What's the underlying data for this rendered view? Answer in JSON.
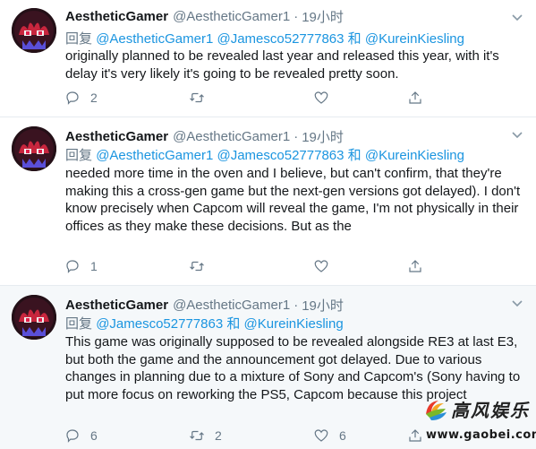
{
  "colors": {
    "accent": "#1b95e0",
    "muted": "#657786",
    "text": "#14171a",
    "divider": "#e6ecf0",
    "highlight_bg": "#f5f8fa"
  },
  "tweets": [
    {
      "display_name": "AestheticGamer",
      "handle": "@AestheticGamer1",
      "dot": "·",
      "time": "19小时",
      "reply_prefix": "回复",
      "mention_1": "@AestheticGamer1",
      "mention_2": "@Jamesco52777863",
      "and_word": "和",
      "mention_3": "@KureinKiesling",
      "text": "originally planned to be revealed last year and released this year, with it's delay it's very likely it's going to be revealed pretty soon.",
      "replies": "2",
      "retweets": "",
      "likes": ""
    },
    {
      "display_name": "AestheticGamer",
      "handle": "@AestheticGamer1",
      "dot": "·",
      "time": "19小时",
      "reply_prefix": "回复",
      "mention_1": "@AestheticGamer1",
      "mention_2": "@Jamesco52777863",
      "and_word": "和",
      "mention_3": "@KureinKiesling",
      "text": "needed more time in the oven and I believe, but can't confirm, that they're making this a cross-gen game but the next-gen versions got delayed). I don't know precisely when Capcom will reveal the game, I'm not physically in their offices as they make these decisions. But as the",
      "replies": "1",
      "retweets": "",
      "likes": ""
    },
    {
      "display_name": "AestheticGamer",
      "handle": "@AestheticGamer1",
      "dot": "·",
      "time": "19小时",
      "reply_prefix": "回复",
      "mention_2": "@Jamesco52777863",
      "and_word": "和",
      "mention_3": "@KureinKiesling",
      "text": "This game was originally supposed to be revealed alongside RE3 at last E3, but both the game and the announcement got delayed. Due to various changes in planning due to a mixture of Sony and Capcom's (Sony having to put more focus on reworking the PS5, Capcom because this project",
      "replies": "6",
      "retweets": "2",
      "likes": "6"
    }
  ],
  "watermark": {
    "text": "高风娱乐",
    "url": "www.gaobei.com"
  }
}
